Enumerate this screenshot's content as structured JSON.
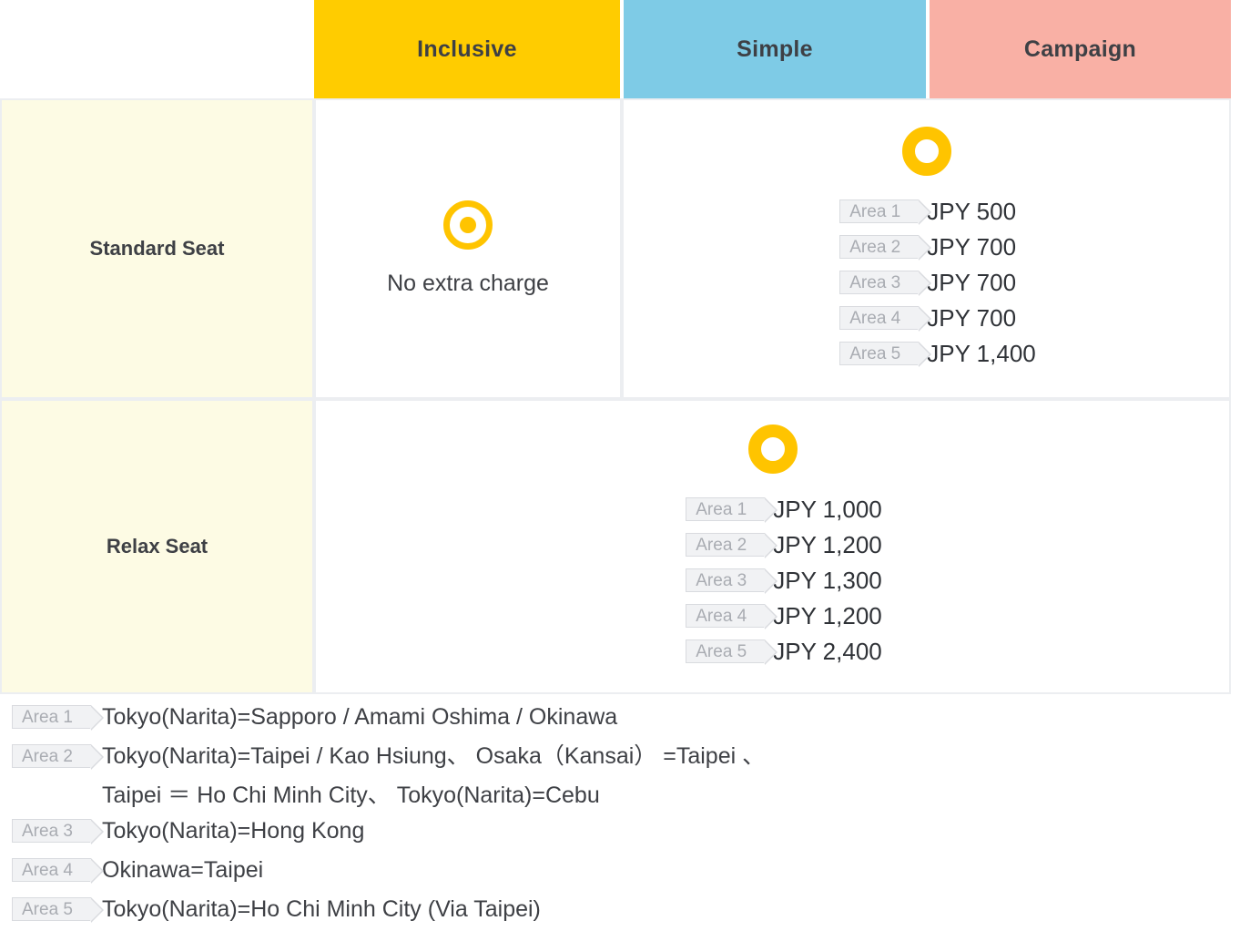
{
  "table": {
    "header": {
      "corner": "",
      "columns": [
        {
          "label": "Inclusive",
          "color": "#ffcc00"
        },
        {
          "label": "Simple",
          "color": "#7ecbe6"
        },
        {
          "label": "Campaign",
          "color": "#f9b0a5"
        }
      ]
    },
    "rows": [
      {
        "label": "Standard Seat",
        "inclusive": {
          "icon": "bullseye-icon",
          "text": "No extra charge"
        },
        "simple_campaign": {
          "icon": "ring-icon",
          "prices": [
            {
              "area": "Area 1",
              "amount": "JPY 500"
            },
            {
              "area": "Area 2",
              "amount": "JPY 700"
            },
            {
              "area": "Area 3",
              "amount": "JPY 700"
            },
            {
              "area": "Area 4",
              "amount": "JPY 700"
            },
            {
              "area": "Area 5",
              "amount": "JPY 1,400"
            }
          ]
        }
      },
      {
        "label": "Relax Seat",
        "merged": {
          "icon": "ring-icon",
          "prices": [
            {
              "area": "Area 1",
              "amount": "JPY 1,000"
            },
            {
              "area": "Area 2",
              "amount": "JPY 1,200"
            },
            {
              "area": "Area 3",
              "amount": "JPY 1,300"
            },
            {
              "area": "Area 4",
              "amount": "JPY 1,200"
            },
            {
              "area": "Area 5",
              "amount": "JPY 2,400"
            }
          ]
        }
      }
    ]
  },
  "legend": [
    {
      "area": "Area 1",
      "text": "Tokyo(Narita)=Sapporo / Amami Oshima / Okinawa",
      "continuation": ""
    },
    {
      "area": "Area 2",
      "text": "Tokyo(Narita)=Taipei / Kao Hsiung、 Osaka（Kansai） =Taipei 、",
      "continuation": "Taipei ＝ Ho Chi Minh City、 Tokyo(Narita)=Cebu"
    },
    {
      "area": "Area 3",
      "text": "Tokyo(Narita)=Hong Kong",
      "continuation": ""
    },
    {
      "area": "Area 4",
      "text": "Okinawa=Taipei",
      "continuation": ""
    },
    {
      "area": "Area 5",
      "text": "Tokyo(Narita)=Ho Chi Minh City (Via Taipei)",
      "continuation": ""
    }
  ],
  "colors": {
    "accent_yellow": "#ffc400",
    "header_yellow": "#ffcc00",
    "header_blue": "#7ecbe6",
    "header_pink": "#f9b0a5",
    "row_label_bg": "#fdfbe4",
    "border": "#eceef1",
    "badge_bg": "#f1f2f4",
    "badge_border": "#d9dbdf",
    "badge_text": "#a9acb2",
    "text": "#3e4045"
  }
}
